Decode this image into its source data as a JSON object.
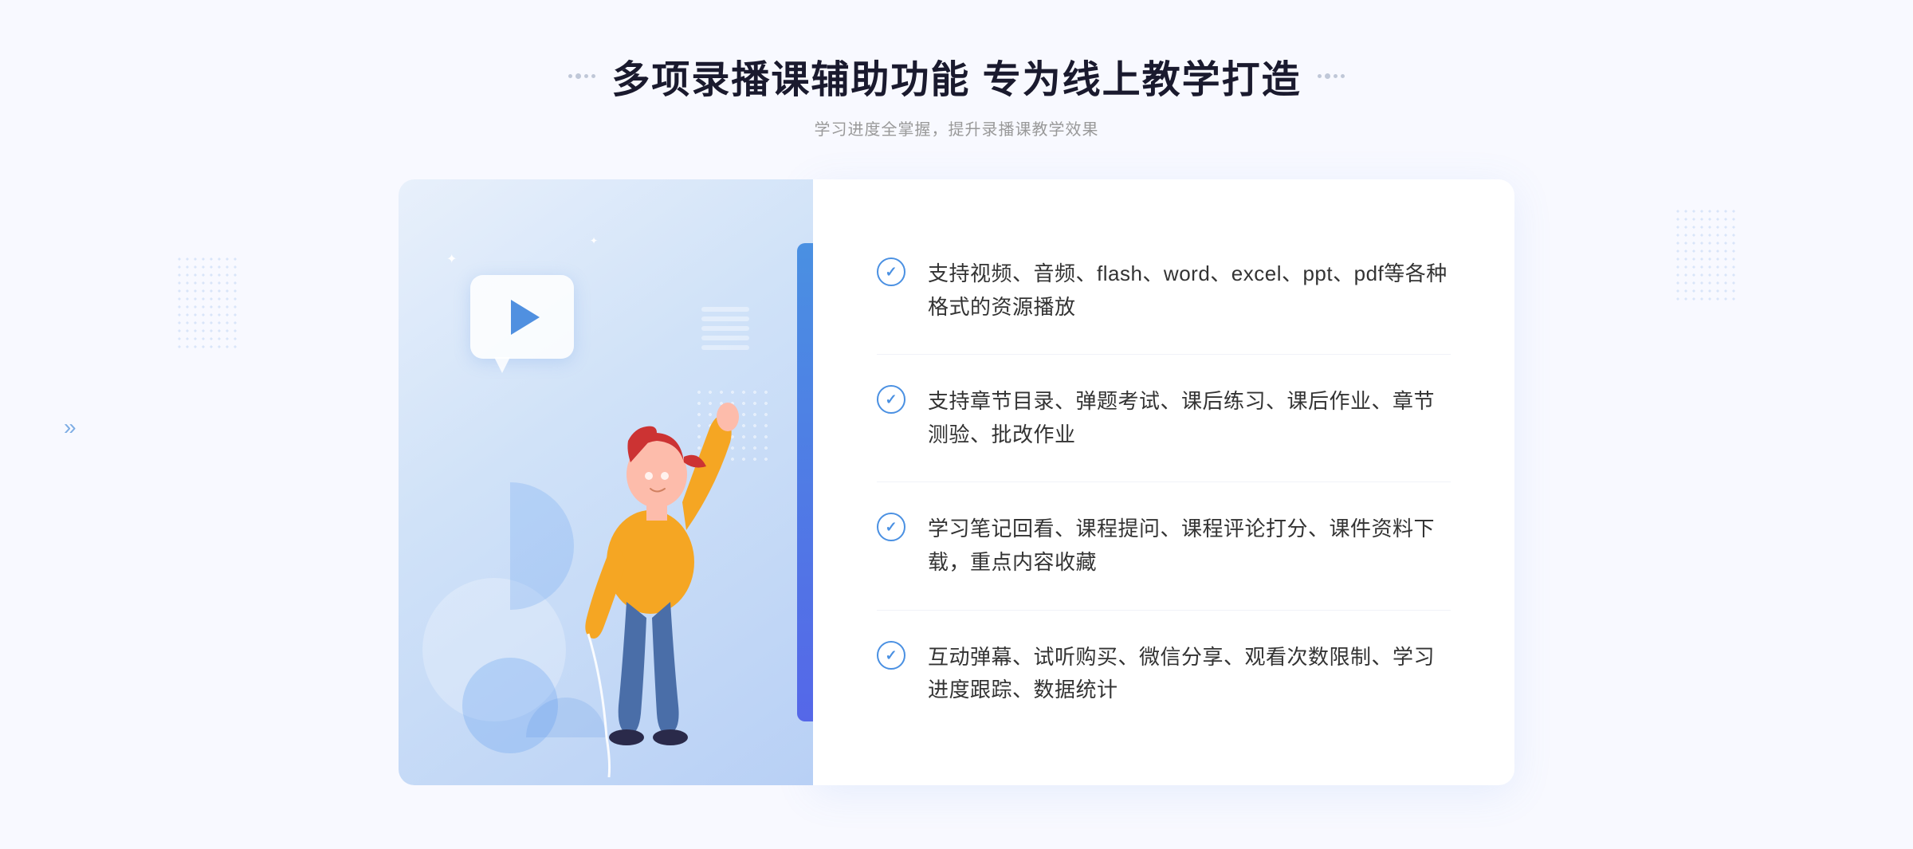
{
  "header": {
    "title": "多项录播课辅助功能 专为线上教学打造",
    "subtitle": "学习进度全掌握，提升录播课教学效果"
  },
  "features": [
    {
      "id": "feature-1",
      "text": "支持视频、音频、flash、word、excel、ppt、pdf等各种格式的资源播放"
    },
    {
      "id": "feature-2",
      "text": "支持章节目录、弹题考试、课后练习、课后作业、章节测验、批改作业"
    },
    {
      "id": "feature-3",
      "text": "学习笔记回看、课程提问、课程评论打分、课件资料下载，重点内容收藏"
    },
    {
      "id": "feature-4",
      "text": "互动弹幕、试听购买、微信分享、观看次数限制、学习进度跟踪、数据统计"
    }
  ],
  "decorations": {
    "chevron": "»"
  },
  "colors": {
    "primary": "#4a90e2",
    "accent": "#5567e8",
    "bg": "#f8f9ff",
    "text_main": "#1a1a2e",
    "text_sub": "#999999",
    "panel_bg": "#ffffff",
    "illustration_bg_start": "#e8f0fb",
    "illustration_bg_end": "#b8d0f5"
  }
}
